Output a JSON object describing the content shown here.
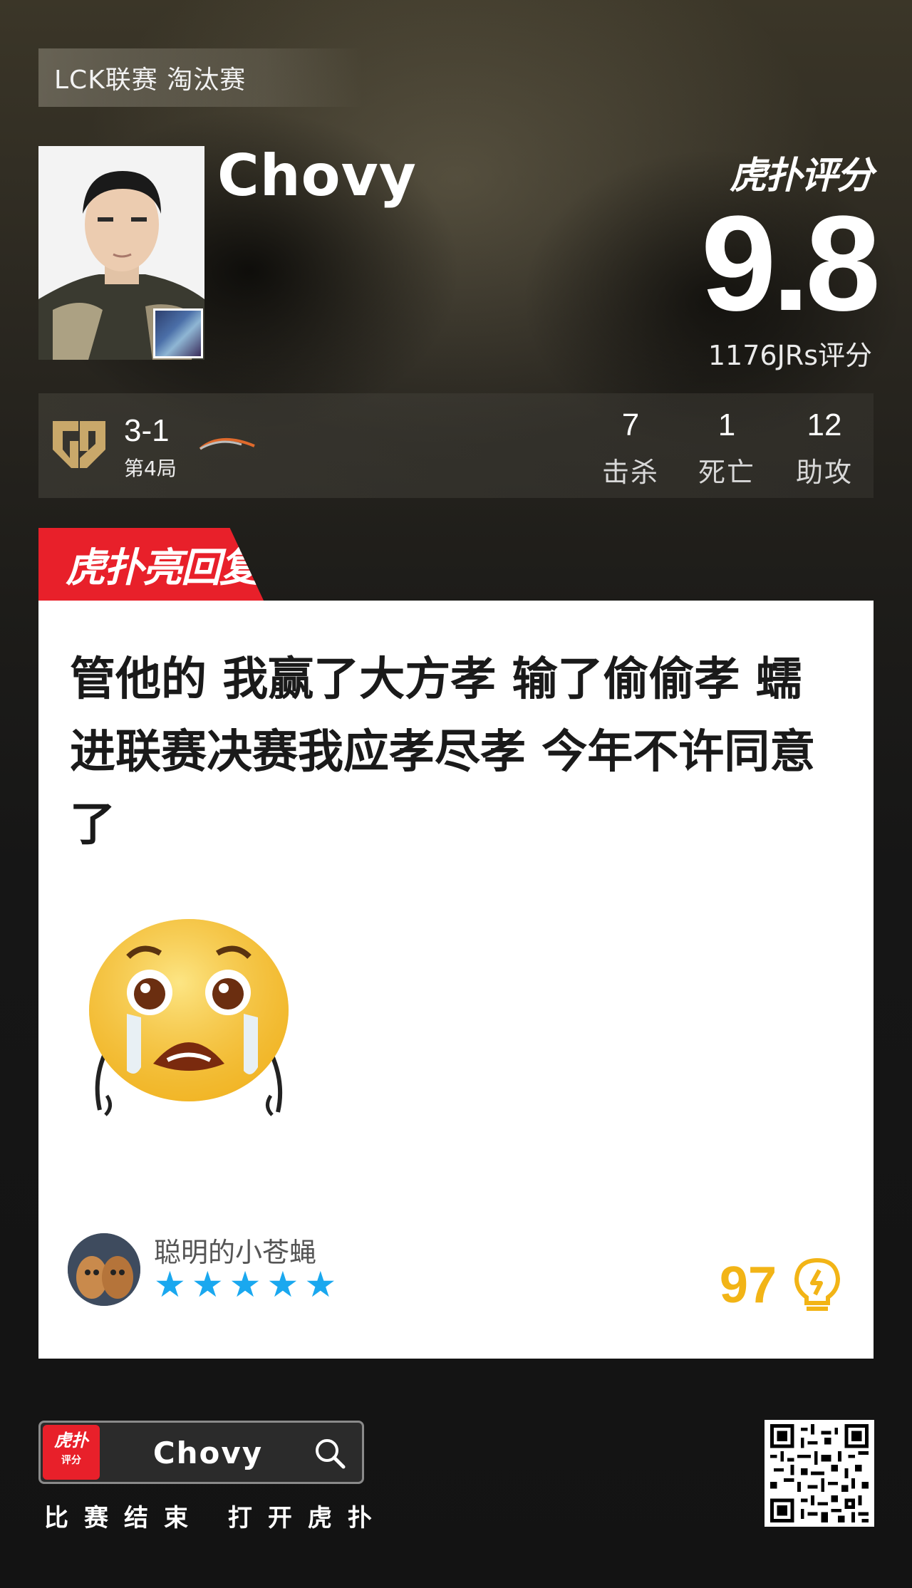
{
  "header": {
    "stage_tag": "LCK联赛 淘汰赛",
    "player_name": "Chovy",
    "score_brand": "虎扑评分",
    "score_value": "9.8",
    "score_count": "1176JRs评分"
  },
  "match": {
    "score": "3-1",
    "game": "第4局",
    "stats": [
      {
        "value": "7",
        "label": "击杀"
      },
      {
        "value": "1",
        "label": "死亡"
      },
      {
        "value": "12",
        "label": "助攻"
      }
    ]
  },
  "comment": {
    "badge": "虎扑亮回复",
    "text": "管他的 我赢了大方孝 输了偷偷孝 蠕进联赛决赛我应孝尽孝 今年不许同意了",
    "user": "聪明的小苍蝇",
    "rating_stars": 5,
    "light_count": "97"
  },
  "footer": {
    "app_logo": "虎扑",
    "app_logo_sub": "评分",
    "search_text": "Chovy",
    "caption": "比赛结束 打开虎扑"
  },
  "colors": {
    "accent_red": "#e8202a",
    "star_blue": "#1aa8ef",
    "light_gold": "#f2b416"
  }
}
